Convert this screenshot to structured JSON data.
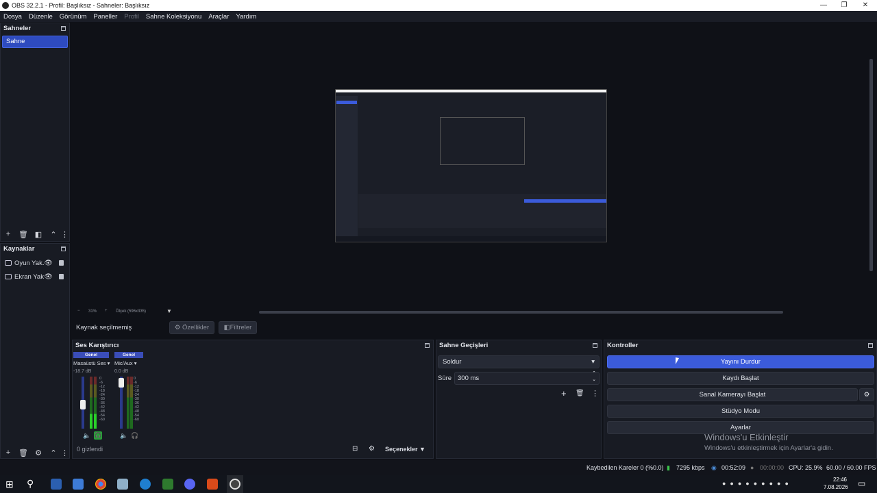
{
  "window": {
    "title": "OBS 32.2.1 - Profil: Başlıksız - Sahneler: Başlıksız"
  },
  "menu": [
    "Dosya",
    "Düzenle",
    "Görünüm",
    "Paneller",
    "Profil",
    "Sahne Koleksiyonu",
    "Araçlar",
    "Yardım"
  ],
  "scenes": {
    "title": "Sahneler",
    "items": [
      "Sahne"
    ]
  },
  "sources": {
    "title": "Kaynaklar",
    "items": [
      "Oyun Yak.",
      "Ekran Yak"
    ]
  },
  "preview": {
    "zoom": "31%",
    "scale": "Ölçek (596x335)"
  },
  "source_bar": {
    "status": "Kaynak seçilmemiş",
    "properties": "Özellikler",
    "filters": "Filtreler"
  },
  "mixer": {
    "title": "Ses Karıştırıcı",
    "channels": [
      {
        "tag": "Genel",
        "name": "Masaüstü Ses",
        "db": "-18.7 dB",
        "fader": 0.5
      },
      {
        "tag": "Genel",
        "name": "Mic/Aux",
        "db": "0.0 dB",
        "fader": 1.0
      }
    ],
    "ticks": [
      "0",
      "-6",
      "-12",
      "-18",
      "-24",
      "-30",
      "-36",
      "-42",
      "-48",
      "-54",
      "-60"
    ],
    "hidden": "0 gizlendi",
    "options": "Seçenekler"
  },
  "transitions": {
    "title": "Sahne Geçişleri",
    "selected": "Soldur",
    "duration_label": "Süre",
    "duration": "300 ms"
  },
  "controls": {
    "title": "Kontroller",
    "stream": "Yayını Durdur",
    "record": "Kaydı Başlat",
    "virtualcam": "Sanal Kamerayı Başlat",
    "studio": "Stüdyo Modu",
    "settings": "Ayarlar"
  },
  "watermark": {
    "line1": "Windows'u Etkinleştir",
    "line2": "Windows'u etkinleştirmek için Ayarlar'a gidin."
  },
  "status": {
    "dropped": "Kaybedilen Kareler 0 (%0.0)",
    "bitrate": "7295 kbps",
    "stream_time": "00:52:09",
    "rec_time": "00:00:00",
    "cpu": "CPU: 25.9%",
    "fps": "60.00 / 60.00 FPS"
  },
  "taskbar": {
    "time": "22:46",
    "date": "7.08.2026"
  }
}
